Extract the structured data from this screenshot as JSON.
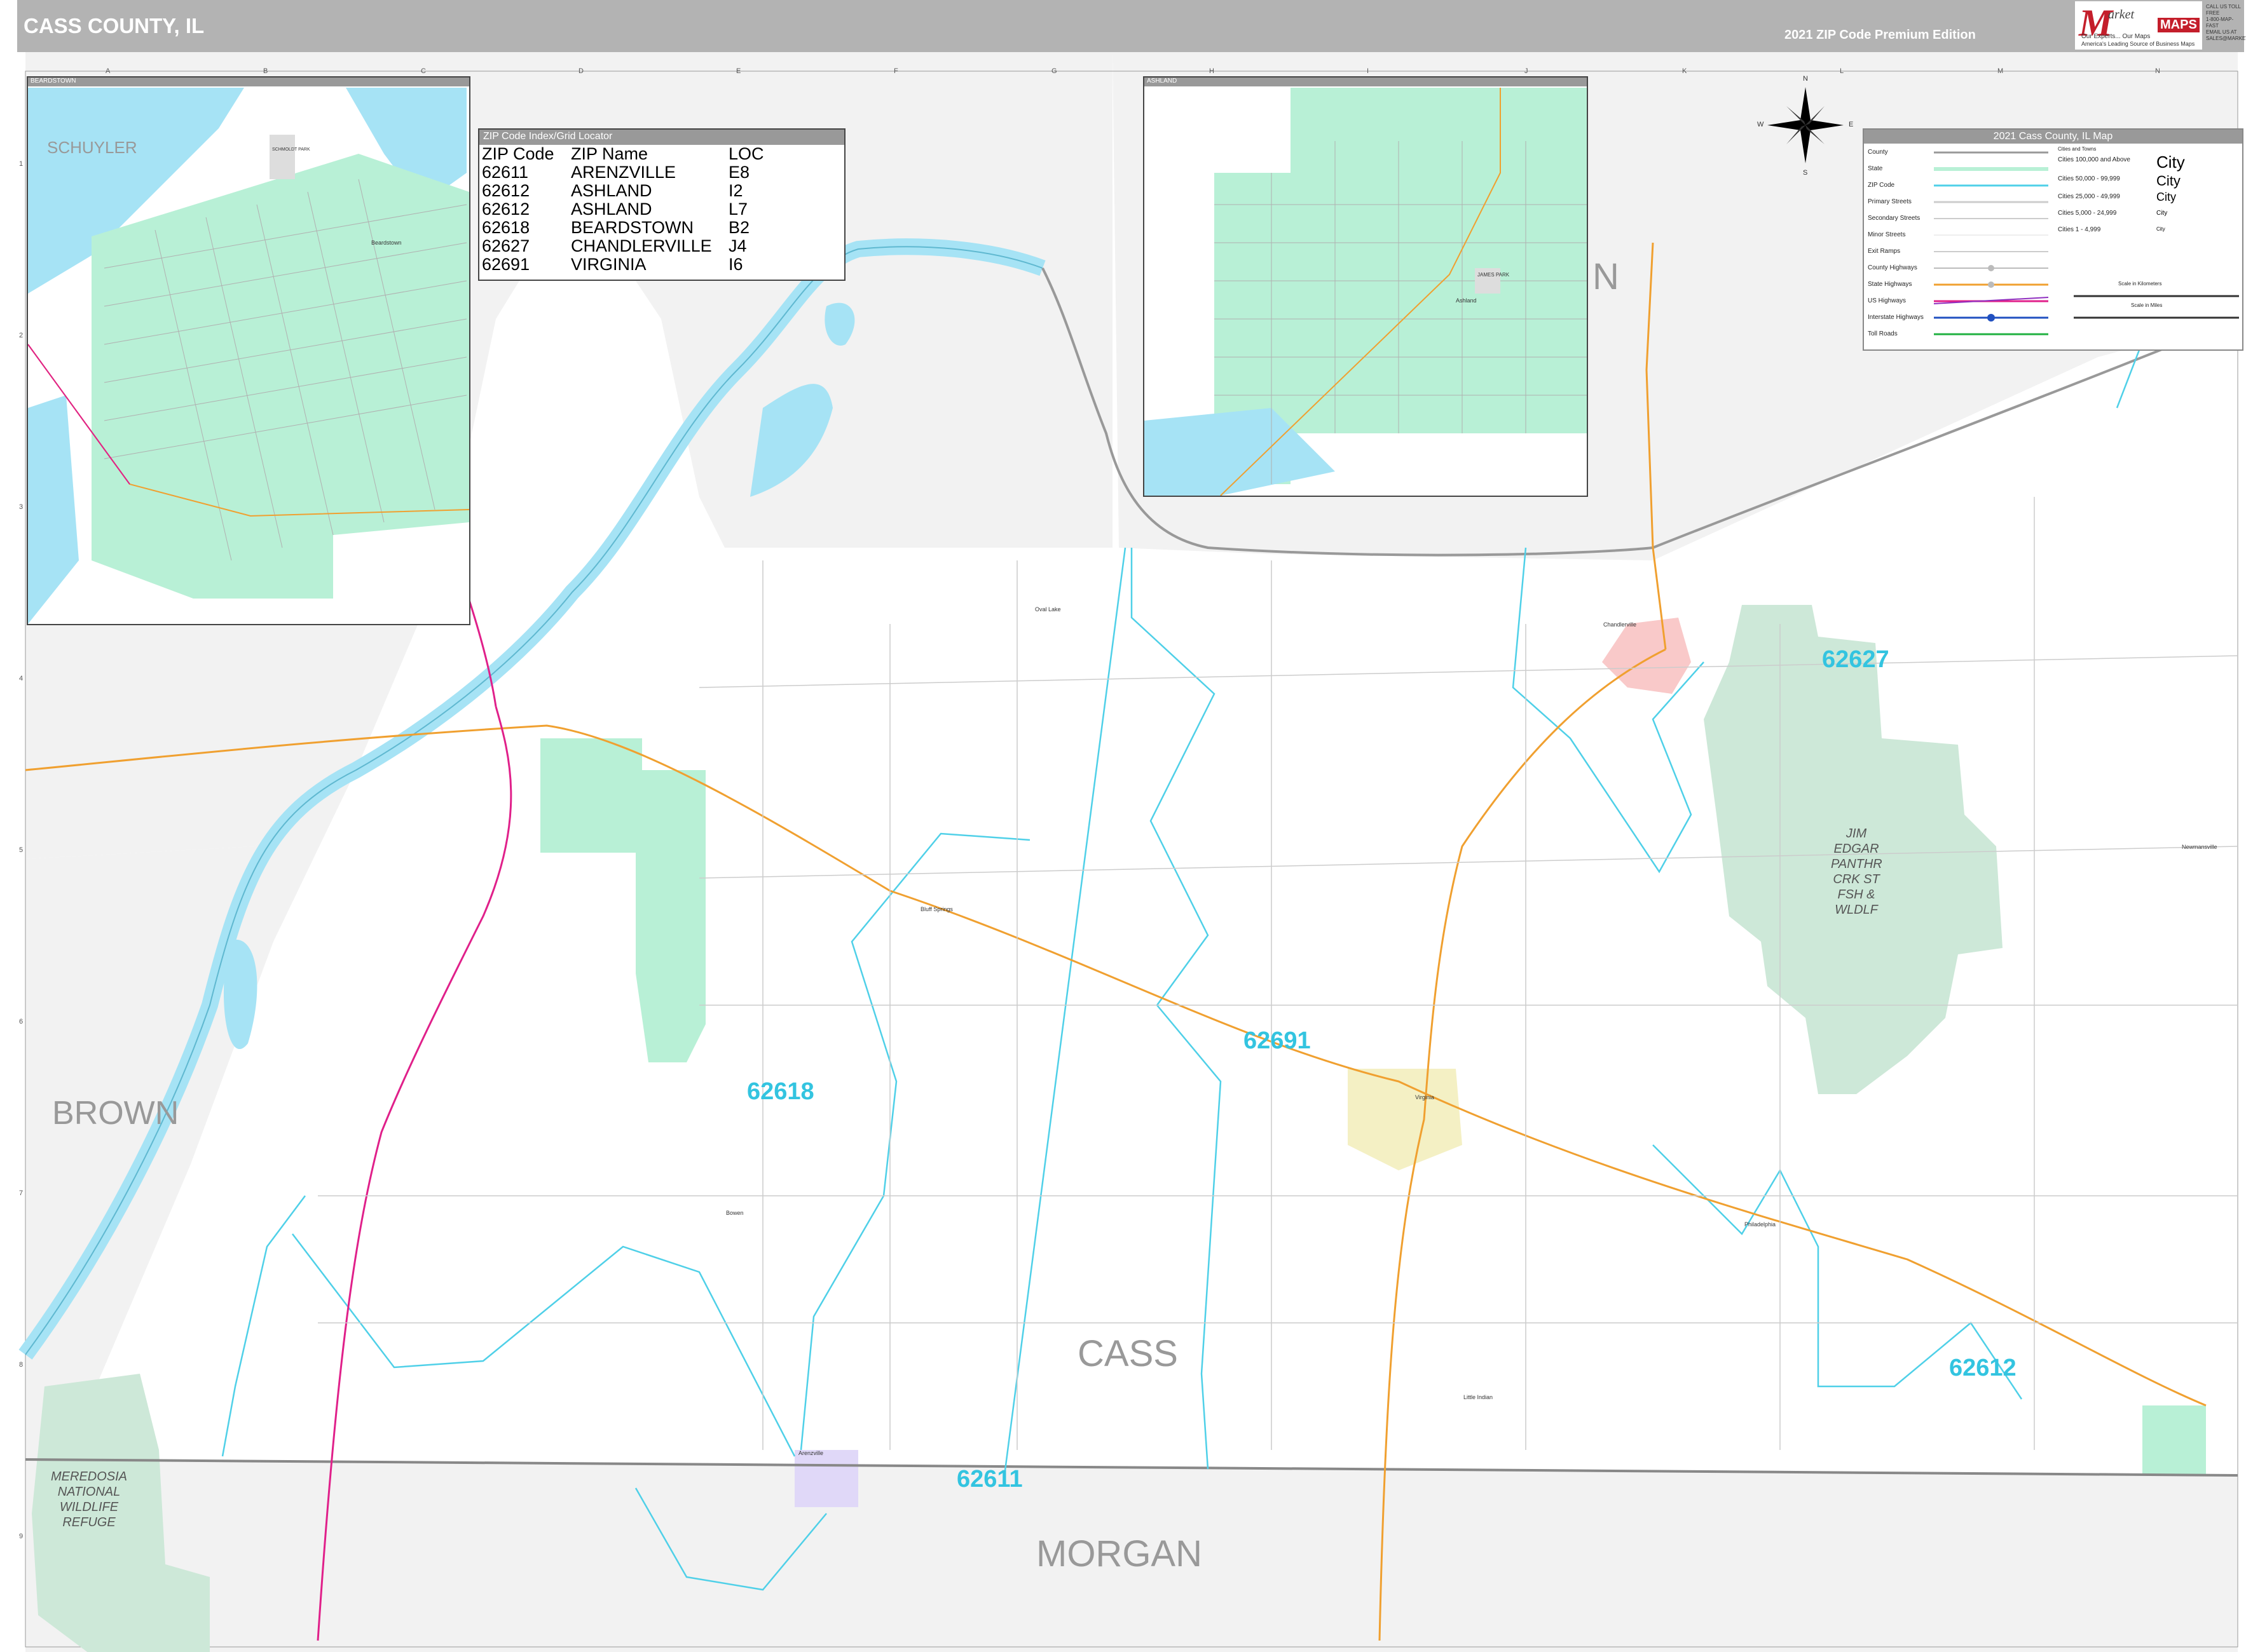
{
  "header": {
    "title": "CASS COUNTY, IL",
    "edition": "2021 ZIP Code Premium Edition"
  },
  "logo": {
    "m": "M",
    "market": "arket",
    "maps": "MAPS",
    "tagline": "Our Experts... Our Maps",
    "subtag": "America's Leading Source of Business Maps",
    "contact": [
      "CALL US TOLL FREE",
      "1-800-MAP-FAST",
      "EMAIL US AT",
      "SALES@MARKETMAPS.COM"
    ]
  },
  "grid": {
    "letters": [
      "A",
      "B",
      "C",
      "D",
      "E",
      "F",
      "G",
      "H",
      "I",
      "J",
      "K",
      "L",
      "M",
      "N"
    ],
    "numbers": [
      "1",
      "2",
      "3",
      "4",
      "5",
      "6",
      "7",
      "8",
      "9"
    ]
  },
  "zip_index": {
    "title": "ZIP Code Index/Grid Locator",
    "headers": [
      "ZIP Code",
      "ZIP Name",
      "LOC"
    ],
    "rows": [
      [
        "62611",
        "ARENZVILLE",
        "E8"
      ],
      [
        "62612",
        "ASHLAND",
        "I2"
      ],
      [
        "62612",
        "ASHLAND",
        "L7"
      ],
      [
        "62618",
        "BEARDSTOWN",
        "B2"
      ],
      [
        "62627",
        "CHANDLERVILLE",
        "J4"
      ],
      [
        "62691",
        "VIRGINIA",
        "I6"
      ]
    ]
  },
  "insets": {
    "beardstown": {
      "title": "BEARDSTOWN",
      "label_schuyler": "SCHUYLER",
      "label_city": "Beardstown",
      "label_park": "SCHMOLDT PARK"
    },
    "ashland": {
      "title": "ASHLAND",
      "label_city": "Ashland",
      "label_park": "JAMES PARK",
      "label_n": "N"
    }
  },
  "legend": {
    "title": "2021 Cass County, IL Map",
    "items": [
      "County",
      "State",
      "ZIP Code",
      "Primary Streets",
      "Secondary Streets",
      "Minor Streets",
      "Exit Ramps",
      "County Highways",
      "State Highways",
      "US Highways",
      "Interstate Highways",
      "Toll Roads"
    ],
    "city_header": "Cities and Towns",
    "cities": [
      "Cities 100,000 and Above",
      "Cities 50,000 - 99,999",
      "Cities 25,000 - 49,999",
      "Cities 5,000 - 24,999",
      "Cities 1 - 4,999"
    ],
    "city_samples": [
      "City",
      "City",
      "City",
      "City",
      "City"
    ],
    "scale_km": "Scale in Kilometers",
    "scale_mi": "Scale in Miles"
  },
  "compass": {
    "n": "N",
    "s": "S",
    "e": "E",
    "w": "W"
  },
  "counties": {
    "cass": "CASS",
    "brown": "BROWN",
    "morgan": "MORGAN",
    "menard_partial": "N"
  },
  "zips": {
    "z62627": "62627",
    "z62691": "62691",
    "z62618": "62618",
    "z62612": "62612",
    "z62611": "62611"
  },
  "parks": {
    "jim_edgar": "JIM\nEDGAR\nPANTHR\nCRK ST\nFSH &\nWLDLF",
    "meredosia": "MEREDOSIA\nNATIONAL\nWILDLIFE\nREFUGE"
  },
  "places": {
    "chandlerville": "Chandlerville",
    "virginia": "Virginia",
    "philadelphia": "Philadelphia",
    "arenzville": "Arenzville",
    "bluff_springs": "Bluff Springs",
    "oval_lake": "Oval Lake",
    "little_indian": "Little Indian",
    "bowen": "Bowen",
    "newmansville": "Newmansville"
  },
  "colors": {
    "header_gray": "#b3b3b3",
    "zip_green": "#b8f0d6",
    "water": "#a6e3f5",
    "zip_line": "#4fd0e8",
    "park_green": "#cde8d8",
    "state_highway": "#f0a030",
    "us_highway": "#e0208a",
    "neighbor_gray": "#f2f2f2"
  }
}
